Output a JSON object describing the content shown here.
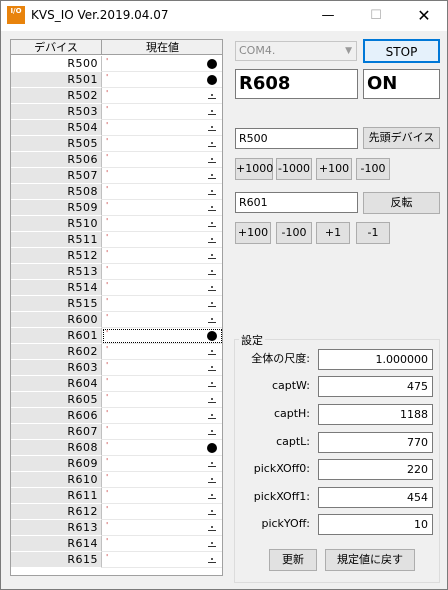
{
  "window": {
    "icon_text": "I/O",
    "title": "KVS_IO Ver.2019.04.07",
    "minimize_glyph": "—",
    "maximize_glyph": "☐",
    "close_glyph": "✕"
  },
  "grid": {
    "columns": [
      "デバイス",
      "現在値"
    ],
    "rows": [
      {
        "device": "R500",
        "on": true
      },
      {
        "device": "R501",
        "on": true
      },
      {
        "device": "R502",
        "on": false
      },
      {
        "device": "R503",
        "on": false
      },
      {
        "device": "R504",
        "on": false
      },
      {
        "device": "R505",
        "on": false
      },
      {
        "device": "R506",
        "on": false
      },
      {
        "device": "R507",
        "on": false
      },
      {
        "device": "R508",
        "on": false
      },
      {
        "device": "R509",
        "on": false
      },
      {
        "device": "R510",
        "on": false
      },
      {
        "device": "R511",
        "on": false
      },
      {
        "device": "R512",
        "on": false
      },
      {
        "device": "R513",
        "on": false
      },
      {
        "device": "R514",
        "on": false
      },
      {
        "device": "R515",
        "on": false
      },
      {
        "device": "R600",
        "on": false
      },
      {
        "device": "R601",
        "on": true,
        "focused": true
      },
      {
        "device": "R602",
        "on": false
      },
      {
        "device": "R603",
        "on": false
      },
      {
        "device": "R604",
        "on": false
      },
      {
        "device": "R605",
        "on": false
      },
      {
        "device": "R606",
        "on": false
      },
      {
        "device": "R607",
        "on": false
      },
      {
        "device": "R608",
        "on": true
      },
      {
        "device": "R609",
        "on": false
      },
      {
        "device": "R610",
        "on": false
      },
      {
        "device": "R611",
        "on": false
      },
      {
        "device": "R612",
        "on": false
      },
      {
        "device": "R613",
        "on": false
      },
      {
        "device": "R614",
        "on": false
      },
      {
        "device": "R615",
        "on": false
      }
    ]
  },
  "connection": {
    "port": "COM4.",
    "stop_label": "STOP"
  },
  "monitor": {
    "device": "R608",
    "state": "ON"
  },
  "head_device": {
    "value": "R500",
    "button_label": "先頭デバイス",
    "steps": [
      "+1000",
      "-1000",
      "+100",
      "-100"
    ]
  },
  "toggle_device": {
    "value": "R601",
    "button_label": "反転",
    "steps": [
      "+100",
      "-100",
      "+1",
      "-1"
    ]
  },
  "settings": {
    "title": "設定",
    "fields": [
      {
        "label": "全体の尺度:",
        "value": "1.000000"
      },
      {
        "label": "captW:",
        "value": "475"
      },
      {
        "label": "captH:",
        "value": "1188"
      },
      {
        "label": "captL:",
        "value": "770"
      },
      {
        "label": "pickXOff0:",
        "value": "220"
      },
      {
        "label": "pickXOff1:",
        "value": "454"
      },
      {
        "label": "pickYOff:",
        "value": "10"
      }
    ],
    "update_label": "更新",
    "reset_label": "規定値に戻す"
  }
}
